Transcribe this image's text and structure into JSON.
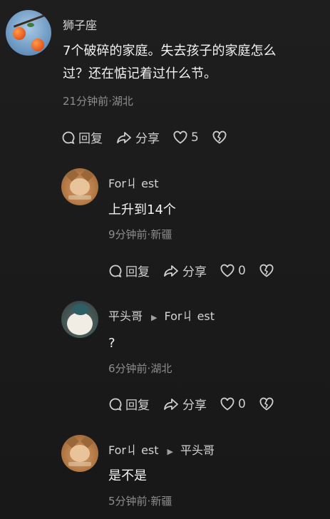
{
  "comments": [
    {
      "author": "狮子座",
      "text_line1": "7个破碎的家庭。失去孩子的家庭怎么",
      "text_line2": "过？还在惦记着过什么节。",
      "time": "21分钟前",
      "location": "湖北",
      "reply_label": "回复",
      "share_label": "分享",
      "like_count": "5"
    },
    {
      "author": "For丩 est",
      "text": "上升到14个",
      "time": "9分钟前",
      "location": "新疆",
      "reply_label": "回复",
      "share_label": "分享",
      "like_count": "0"
    },
    {
      "author": "平头哥",
      "reply_to": "For丩 est",
      "text": "?",
      "time": "6分钟前",
      "location": "湖北",
      "reply_label": "回复",
      "share_label": "分享",
      "like_count": "0"
    },
    {
      "author": "For丩 est",
      "reply_to": "平头哥",
      "text": "是不是",
      "time": "5分钟前",
      "location": "新疆"
    }
  ],
  "meta_sep": "·",
  "colors": {
    "background": "#1b1b1b",
    "text": "#f2f2f2",
    "muted": "#8e8e8e"
  }
}
